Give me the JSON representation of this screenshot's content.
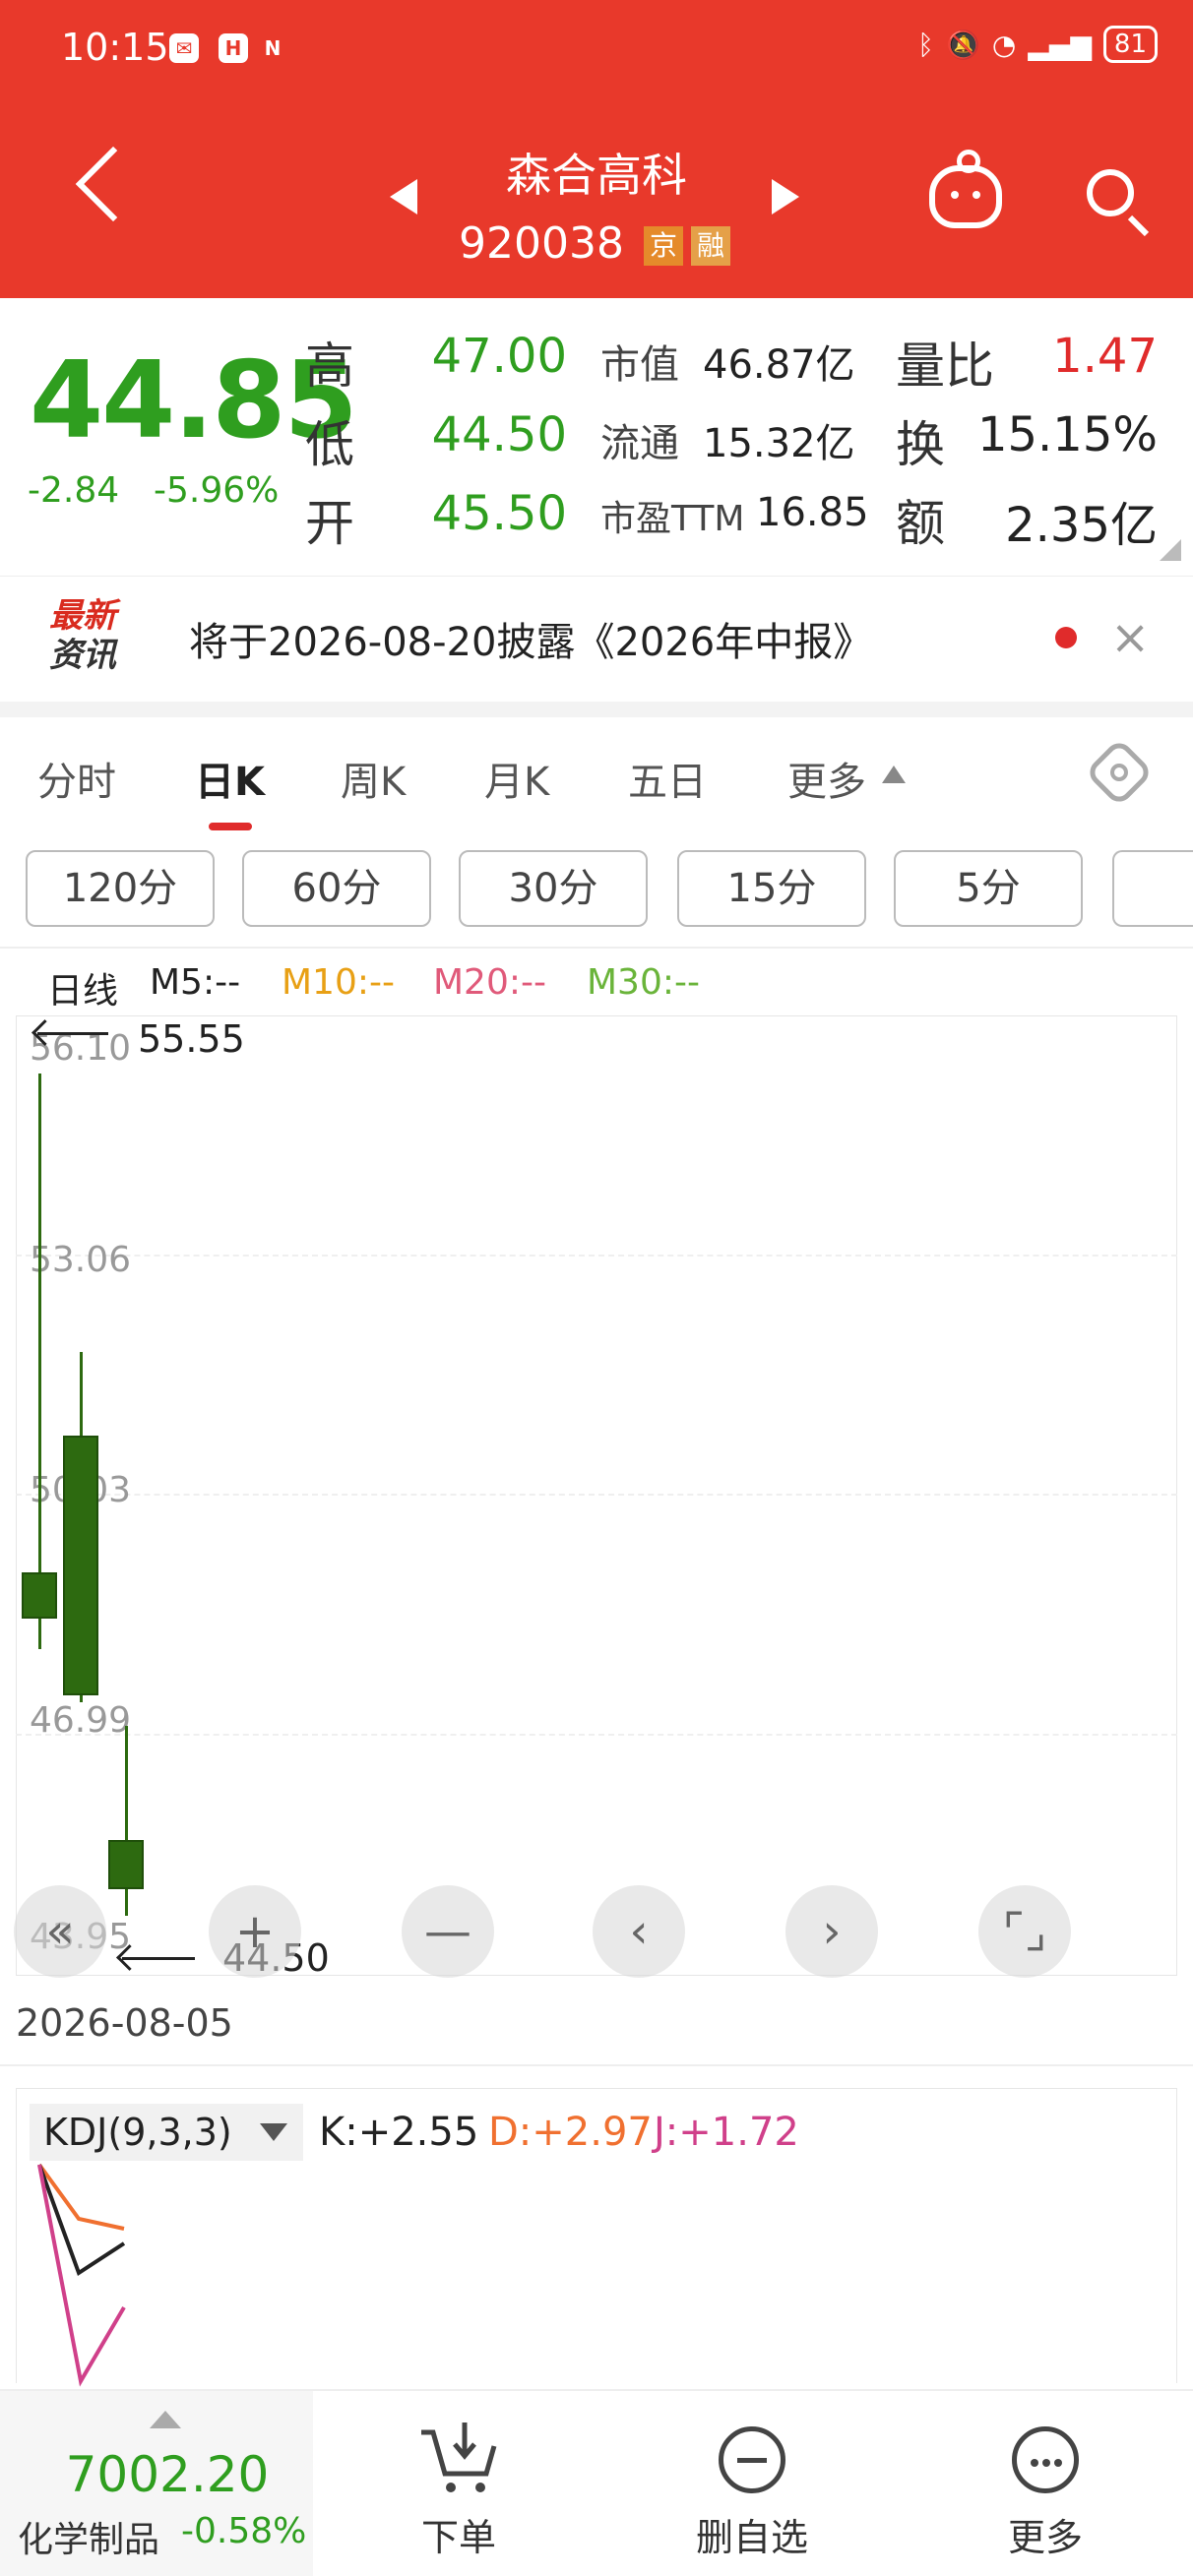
{
  "status_bar": {
    "time": "10:15",
    "battery": "81"
  },
  "header": {
    "stock_name": "森合高科",
    "stock_code": "920038",
    "tag_exchange": "京",
    "tag_margin": "融"
  },
  "quote": {
    "price": "44.85",
    "change": "-2.84",
    "change_pct": "-5.96%",
    "high_label": "高",
    "high": "47.00",
    "low_label": "低",
    "low": "44.50",
    "open_label": "开",
    "open": "45.50",
    "mcap_label": "市值",
    "mcap": "46.87亿",
    "float_label": "流通",
    "float": "15.32亿",
    "pe_label": "市盈TTM",
    "pe": "16.85",
    "vol_ratio_label": "量比",
    "vol_ratio": "1.47",
    "turnover_label": "换",
    "turnover": "15.15%",
    "amount_label": "额",
    "amount": "2.35亿"
  },
  "news": {
    "logo_top": "最新",
    "logo_bottom": "资讯",
    "text": "将于2026-08-20披露《2026年中报》"
  },
  "tabs": [
    "分时",
    "日K",
    "周K",
    "月K",
    "五日",
    "更多"
  ],
  "periods": [
    "120分",
    "60分",
    "30分",
    "15分",
    "5分"
  ],
  "ma": {
    "label": "日线",
    "m5": "M5:--",
    "m10": "M10:--",
    "m20": "M20:--",
    "m30": "M30:--"
  },
  "colors": {
    "header_red": "#e8392b",
    "down_green": "#2f9e1f",
    "up_red": "#e02b2b",
    "candle": "#2d6a10"
  },
  "chart_data": {
    "type": "candlestick",
    "y_ticks": [
      "56.10",
      "53.06",
      "50.03",
      "46.99",
      "43.95"
    ],
    "ylim": [
      43.95,
      56.1
    ],
    "high_annotation": "55.55",
    "low_annotation": "44.50",
    "candles": [
      {
        "open": 49.0,
        "close": 48.4,
        "high": 55.55,
        "low": 48.0
      },
      {
        "open": 50.8,
        "close": 47.4,
        "high": 51.9,
        "low": 47.3
      },
      {
        "open": 45.5,
        "close": 44.85,
        "high": 47.0,
        "low": 44.5
      }
    ]
  },
  "date": "2026-08-05",
  "kdj": {
    "selector": "KDJ(9,3,3)",
    "k": "K:+2.55",
    "d": "D:+2.97",
    "j": "J:+1.72",
    "k_color": "#222222",
    "d_color": "#f07030",
    "j_color": "#d0408a"
  },
  "bottom_bar": {
    "index_value": "7002.20",
    "index_name": "化学制品",
    "index_pct": "-0.58%",
    "order_label": "下单",
    "remove_label": "删自选",
    "more_label": "更多"
  }
}
